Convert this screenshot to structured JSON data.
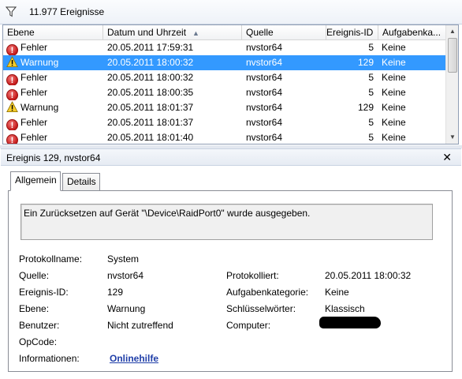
{
  "filter": {
    "icon": "funnel-icon",
    "event_count": "11.977 Ereignisse"
  },
  "grid": {
    "columns": [
      "Ebene",
      "Datum und Uhrzeit",
      "Quelle",
      "Ereignis-ID",
      "Aufgabenka..."
    ],
    "sorted_column": "Datum und Uhrzeit",
    "sort_direction": "ascending",
    "rows": [
      {
        "level": "Fehler",
        "level_icon": "error-icon",
        "date": "20.05.2011 17:59:31",
        "source": "nvstor64",
        "id": "5",
        "task": "Keine"
      },
      {
        "level": "Warnung",
        "level_icon": "warning-icon",
        "date": "20.05.2011 18:00:32",
        "source": "nvstor64",
        "id": "129",
        "task": "Keine",
        "selected": true
      },
      {
        "level": "Fehler",
        "level_icon": "error-icon",
        "date": "20.05.2011 18:00:32",
        "source": "nvstor64",
        "id": "5",
        "task": "Keine"
      },
      {
        "level": "Fehler",
        "level_icon": "error-icon",
        "date": "20.05.2011 18:00:35",
        "source": "nvstor64",
        "id": "5",
        "task": "Keine"
      },
      {
        "level": "Warnung",
        "level_icon": "warning-icon",
        "date": "20.05.2011 18:01:37",
        "source": "nvstor64",
        "id": "129",
        "task": "Keine"
      },
      {
        "level": "Fehler",
        "level_icon": "error-icon",
        "date": "20.05.2011 18:01:37",
        "source": "nvstor64",
        "id": "5",
        "task": "Keine"
      },
      {
        "level": "Fehler",
        "level_icon": "error-icon",
        "date": "20.05.2011 18:01:40",
        "source": "nvstor64",
        "id": "5",
        "task": "Keine"
      }
    ]
  },
  "detail": {
    "title": "Ereignis 129, nvstor64",
    "close_label": "✕",
    "tabs": {
      "general": "Allgemein",
      "details": "Details"
    },
    "message": "Ein Zurücksetzen auf Gerät \"\\Device\\RaidPort0\" wurde ausgegeben.",
    "fields": {
      "log_name": {
        "label": "Protokollname:",
        "value": "System"
      },
      "source": {
        "label": "Quelle:",
        "value": "nvstor64"
      },
      "event_id": {
        "label": "Ereignis-ID:",
        "value": "129"
      },
      "level": {
        "label": "Ebene:",
        "value": "Warnung"
      },
      "user": {
        "label": "Benutzer:",
        "value": "Nicht zutreffend"
      },
      "opcode": {
        "label": "OpCode:",
        "value": ""
      },
      "info": {
        "label": "Informationen:",
        "value": "Onlinehilfe"
      },
      "logged": {
        "label": "Protokolliert:",
        "value": "20.05.2011 18:00:32"
      },
      "category": {
        "label": "Aufgabenkategorie:",
        "value": "Keine"
      },
      "keywords": {
        "label": "Schlüsselwörter:",
        "value": "Klassisch"
      },
      "computer": {
        "label": "Computer:",
        "value": ""
      }
    }
  },
  "colors": {
    "selection": "#3399ff",
    "link": "#1f3ea8"
  }
}
